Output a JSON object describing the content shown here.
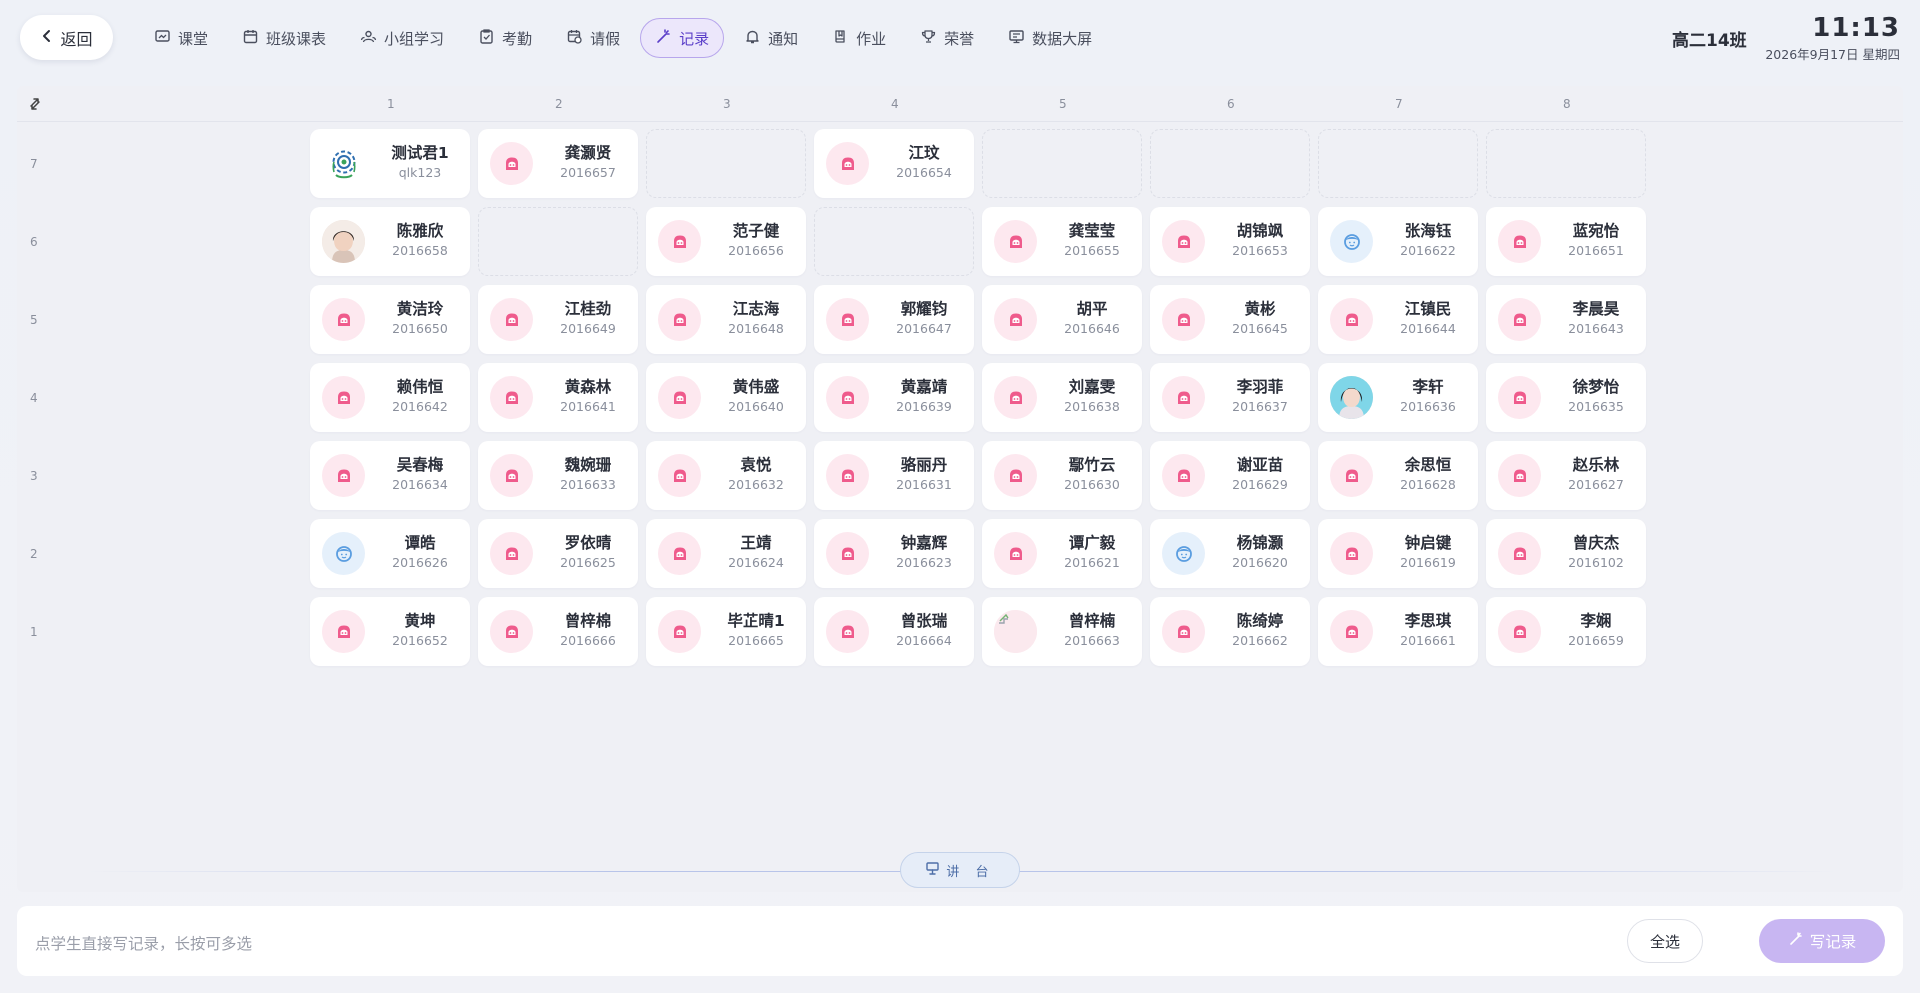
{
  "header": {
    "back_label": "返回",
    "nav": [
      {
        "label": "课堂",
        "icon": "screen-icon"
      },
      {
        "label": "班级课表",
        "icon": "calendar-icon"
      },
      {
        "label": "小组学习",
        "icon": "group-icon"
      },
      {
        "label": "考勤",
        "icon": "clipboard-check-icon"
      },
      {
        "label": "请假",
        "icon": "calendar-clock-icon"
      },
      {
        "label": "记录",
        "icon": "magic-pen-icon",
        "active": true
      },
      {
        "label": "通知",
        "icon": "bell-icon"
      },
      {
        "label": "作业",
        "icon": "book-icon"
      },
      {
        "label": "荣誉",
        "icon": "trophy-icon"
      },
      {
        "label": "数据大屏",
        "icon": "monitor-icon"
      }
    ],
    "class_name": "高二14班",
    "time": "11:13",
    "date": "2026年9月17日 星期四"
  },
  "grid": {
    "columns": [
      "1",
      "2",
      "3",
      "4",
      "5",
      "6",
      "7",
      "8"
    ],
    "rows": [
      {
        "label": "7",
        "seats": [
          {
            "name": "测试君1",
            "id": "qlk123",
            "avatar": "gear"
          },
          {
            "name": "龚灏贤",
            "id": "2016657",
            "avatar": "pink"
          },
          null,
          {
            "name": "江玟",
            "id": "2016654",
            "avatar": "pink"
          },
          null,
          null,
          null,
          null
        ]
      },
      {
        "label": "6",
        "seats": [
          {
            "name": "陈雅欣",
            "id": "2016658",
            "avatar": "photo"
          },
          null,
          {
            "name": "范子健",
            "id": "2016656",
            "avatar": "pink"
          },
          null,
          {
            "name": "龚莹莹",
            "id": "2016655",
            "avatar": "pink"
          },
          {
            "name": "胡锦飒",
            "id": "2016653",
            "avatar": "pink"
          },
          {
            "name": "张海钰",
            "id": "2016622",
            "avatar": "blue"
          },
          {
            "name": "蓝宛怡",
            "id": "2016651",
            "avatar": "pink"
          }
        ]
      },
      {
        "label": "5",
        "seats": [
          {
            "name": "黄洁玲",
            "id": "2016650",
            "avatar": "pink"
          },
          {
            "name": "江桂劲",
            "id": "2016649",
            "avatar": "pink"
          },
          {
            "name": "江志海",
            "id": "2016648",
            "avatar": "pink"
          },
          {
            "name": "郭耀钧",
            "id": "2016647",
            "avatar": "pink"
          },
          {
            "name": "胡平",
            "id": "2016646",
            "avatar": "pink"
          },
          {
            "name": "黄彬",
            "id": "2016645",
            "avatar": "pink"
          },
          {
            "name": "江镇民",
            "id": "2016644",
            "avatar": "pink"
          },
          {
            "name": "李晨昊",
            "id": "2016643",
            "avatar": "pink"
          }
        ]
      },
      {
        "label": "4",
        "seats": [
          {
            "name": "赖伟恒",
            "id": "2016642",
            "avatar": "pink"
          },
          {
            "name": "黄森林",
            "id": "2016641",
            "avatar": "pink"
          },
          {
            "name": "黄伟盛",
            "id": "2016640",
            "avatar": "pink"
          },
          {
            "name": "黄嘉靖",
            "id": "2016639",
            "avatar": "pink"
          },
          {
            "name": "刘嘉雯",
            "id": "2016638",
            "avatar": "pink"
          },
          {
            "name": "李羽菲",
            "id": "2016637",
            "avatar": "pink"
          },
          {
            "name": "李轩",
            "id": "2016636",
            "avatar": "photo2"
          },
          {
            "name": "徐梦怡",
            "id": "2016635",
            "avatar": "pink"
          }
        ]
      },
      {
        "label": "3",
        "seats": [
          {
            "name": "吴春梅",
            "id": "2016634",
            "avatar": "pink"
          },
          {
            "name": "魏婉珊",
            "id": "2016633",
            "avatar": "pink"
          },
          {
            "name": "袁悦",
            "id": "2016632",
            "avatar": "pink"
          },
          {
            "name": "骆丽丹",
            "id": "2016631",
            "avatar": "pink"
          },
          {
            "name": "鄢竹云",
            "id": "2016630",
            "avatar": "pink"
          },
          {
            "name": "谢亚苗",
            "id": "2016629",
            "avatar": "pink"
          },
          {
            "name": "余思恒",
            "id": "2016628",
            "avatar": "pink"
          },
          {
            "name": "赵乐林",
            "id": "2016627",
            "avatar": "pink"
          }
        ]
      },
      {
        "label": "2",
        "seats": [
          {
            "name": "谭皓",
            "id": "2016626",
            "avatar": "blue"
          },
          {
            "name": "罗依晴",
            "id": "2016625",
            "avatar": "pink"
          },
          {
            "name": "王靖",
            "id": "2016624",
            "avatar": "pink"
          },
          {
            "name": "钟嘉辉",
            "id": "2016623",
            "avatar": "pink"
          },
          {
            "name": "谭广毅",
            "id": "2016621",
            "avatar": "pink"
          },
          {
            "name": "杨锦灏",
            "id": "2016620",
            "avatar": "blue"
          },
          {
            "name": "钟启键",
            "id": "2016619",
            "avatar": "pink"
          },
          {
            "name": "曾庆杰",
            "id": "2016102",
            "avatar": "pink"
          }
        ]
      },
      {
        "label": "1",
        "seats": [
          {
            "name": "黄坤",
            "id": "2016652",
            "avatar": "pink"
          },
          {
            "name": "曾梓棉",
            "id": "2016666",
            "avatar": "pink"
          },
          {
            "name": "毕芷晴1",
            "id": "2016665",
            "avatar": "pink"
          },
          {
            "name": "曾张瑞",
            "id": "2016664",
            "avatar": "pink"
          },
          {
            "name": "曾梓楠",
            "id": "2016663",
            "avatar": "broken"
          },
          {
            "name": "陈绮婷",
            "id": "2016662",
            "avatar": "pink"
          },
          {
            "name": "李思琪",
            "id": "2016661",
            "avatar": "pink"
          },
          {
            "name": "李娴",
            "id": "2016659",
            "avatar": "pink"
          }
        ]
      }
    ]
  },
  "podium_label": "讲 台",
  "bottom": {
    "hint": "点学生直接写记录，长按可多选",
    "select_all": "全选",
    "write_record": "写记录"
  },
  "colors": {
    "accent": "#5b3fc9",
    "accent_light": "#c8b6f2",
    "pink_avatar": "#ef5b8c",
    "blue_avatar": "#5a9de0"
  }
}
